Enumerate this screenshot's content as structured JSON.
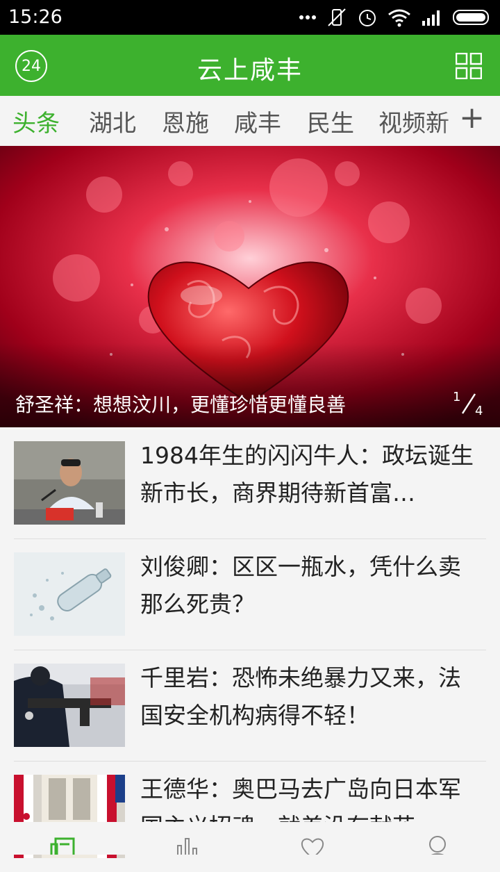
{
  "status": {
    "time": "15:26"
  },
  "app": {
    "title": "云上咸丰",
    "badge": "24"
  },
  "tabs": [
    {
      "label": "头条",
      "active": true
    },
    {
      "label": "湖北",
      "active": false
    },
    {
      "label": "恩施",
      "active": false
    },
    {
      "label": "咸丰",
      "active": false
    },
    {
      "label": "民生",
      "active": false
    },
    {
      "label": "视频新",
      "active": false
    }
  ],
  "tabs_add": "+",
  "hero": {
    "caption": "舒圣祥：想想汶川，更懂珍惜更懂良善",
    "page_current": "1",
    "page_total": "4"
  },
  "news": [
    {
      "title": "1984年生的闪闪牛人：政坛诞生新市长，商界期待新首富…",
      "thumb": "official-speaking"
    },
    {
      "title": "刘俊卿：区区一瓶水，凭什么卖那么死贵？",
      "thumb": "water-bottle"
    },
    {
      "title": "千里岩：恐怖未绝暴力又来，法国安全机构病得不轻！",
      "thumb": "armed-police"
    },
    {
      "title": "王德华：奥巴马去广岛向日本军国主义招魂，就差没有献花",
      "thumb": "flags-podium"
    }
  ],
  "colors": {
    "accent": "#3db12e"
  }
}
